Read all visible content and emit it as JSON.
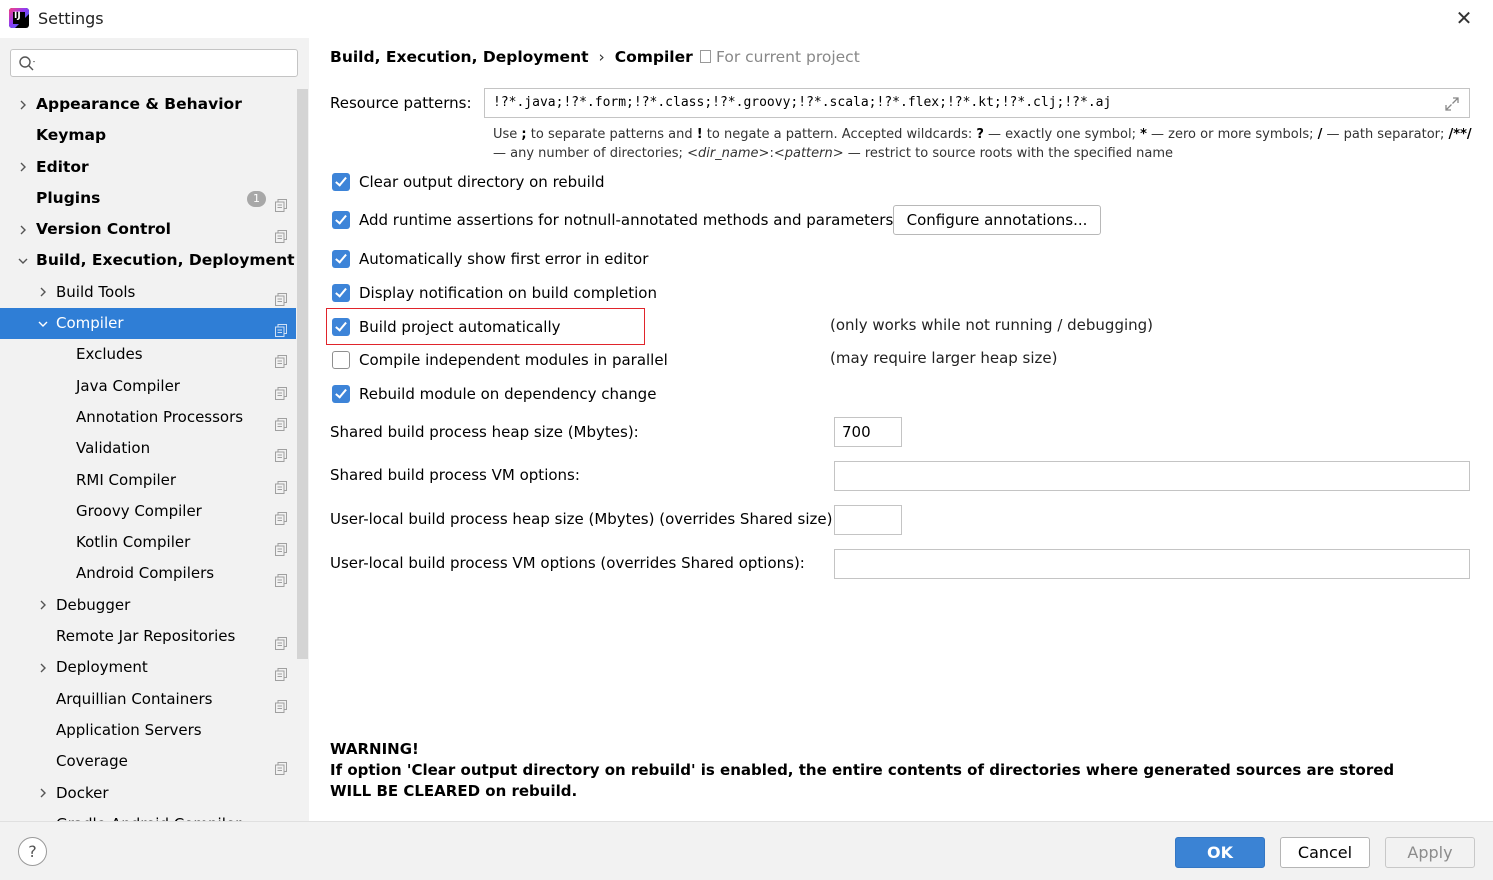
{
  "window": {
    "title": "Settings"
  },
  "sidebar": {
    "search_placeholder": "",
    "items": [
      {
        "label": "Appearance & Behavior",
        "level": 0,
        "arrow": "right",
        "copy": false
      },
      {
        "label": "Keymap",
        "level": 0,
        "arrow": "none",
        "copy": false
      },
      {
        "label": "Editor",
        "level": 0,
        "arrow": "right",
        "copy": false
      },
      {
        "label": "Plugins",
        "level": 0,
        "arrow": "none",
        "copy": true,
        "badge": "1"
      },
      {
        "label": "Version Control",
        "level": 0,
        "arrow": "right",
        "copy": true
      },
      {
        "label": "Build, Execution, Deployment",
        "level": 0,
        "arrow": "down",
        "copy": false
      },
      {
        "label": "Build Tools",
        "level": 1,
        "arrow": "right",
        "copy": true
      },
      {
        "label": "Compiler",
        "level": 1,
        "arrow": "down",
        "copy": true,
        "selected": true
      },
      {
        "label": "Excludes",
        "level": 2,
        "arrow": "none",
        "copy": true
      },
      {
        "label": "Java Compiler",
        "level": 2,
        "arrow": "none",
        "copy": true
      },
      {
        "label": "Annotation Processors",
        "level": 2,
        "arrow": "none",
        "copy": true
      },
      {
        "label": "Validation",
        "level": 2,
        "arrow": "none",
        "copy": true
      },
      {
        "label": "RMI Compiler",
        "level": 2,
        "arrow": "none",
        "copy": true
      },
      {
        "label": "Groovy Compiler",
        "level": 2,
        "arrow": "none",
        "copy": true
      },
      {
        "label": "Kotlin Compiler",
        "level": 2,
        "arrow": "none",
        "copy": true
      },
      {
        "label": "Android Compilers",
        "level": 2,
        "arrow": "none",
        "copy": true
      },
      {
        "label": "Debugger",
        "level": 1,
        "arrow": "right",
        "copy": false
      },
      {
        "label": "Remote Jar Repositories",
        "level": 1,
        "arrow": "none",
        "copy": true
      },
      {
        "label": "Deployment",
        "level": 1,
        "arrow": "right",
        "copy": true
      },
      {
        "label": "Arquillian Containers",
        "level": 1,
        "arrow": "none",
        "copy": true
      },
      {
        "label": "Application Servers",
        "level": 1,
        "arrow": "none",
        "copy": false
      },
      {
        "label": "Coverage",
        "level": 1,
        "arrow": "none",
        "copy": true
      },
      {
        "label": "Docker",
        "level": 1,
        "arrow": "right",
        "copy": false
      },
      {
        "label": "Gradle-Android Compiler",
        "level": 1,
        "arrow": "none",
        "copy": true
      }
    ]
  },
  "breadcrumb": {
    "parent": "Build, Execution, Deployment",
    "separator": "›",
    "current": "Compiler",
    "scope": "For current project"
  },
  "resource_patterns": {
    "label": "Resource patterns:",
    "value": "!?*.java;!?*.form;!?*.class;!?*.groovy;!?*.scala;!?*.flex;!?*.kt;!?*.clj;!?*.aj",
    "help": {
      "p1": "Use ",
      "b1": ";",
      "p2": " to separate patterns and ",
      "b2": "!",
      "p3": " to negate a pattern. Accepted wildcards: ",
      "b3": "?",
      "p4": " — exactly one symbol; ",
      "b4": "*",
      "p5": " — zero or more symbols; ",
      "b5": "/",
      "p6": " — path separator; ",
      "b6": "/**/",
      "p7": " — any number of directories; ",
      "i1": "<dir_name>",
      "p8": ":",
      "i2": "<pattern>",
      "p9": " — restrict to source roots with the specified name"
    }
  },
  "options": {
    "clear_output": {
      "label": "Clear output directory on rebuild",
      "checked": true
    },
    "runtime_assertions": {
      "label": "Add runtime assertions for notnull-annotated methods and parameters",
      "checked": true
    },
    "configure_annotations": "Configure annotations...",
    "show_first_error": {
      "label": "Automatically show first error in editor",
      "checked": true
    },
    "notify_completion": {
      "label": "Display notification on build completion",
      "checked": true
    },
    "build_auto": {
      "label": "Build project automatically",
      "checked": true,
      "note": "(only works while not running / debugging)"
    },
    "parallel": {
      "label": "Compile independent modules in parallel",
      "checked": false,
      "note": "(may require larger heap size)"
    },
    "rebuild_dep": {
      "label": "Rebuild module on dependency change",
      "checked": true
    }
  },
  "fields": {
    "shared_heap": {
      "label": "Shared build process heap size (Mbytes):",
      "value": "700"
    },
    "shared_vm": {
      "label": "Shared build process VM options:",
      "value": ""
    },
    "user_heap": {
      "label": "User-local build process heap size (Mbytes) (overrides Shared size):",
      "value": ""
    },
    "user_vm": {
      "label": "User-local build process VM options (overrides Shared options):",
      "value": ""
    }
  },
  "warning": {
    "title": "WARNING!",
    "text": "If option 'Clear output directory on rebuild' is enabled, the entire contents of directories where generated sources are stored WILL BE CLEARED on rebuild."
  },
  "footer": {
    "help": "?",
    "ok": "OK",
    "cancel": "Cancel",
    "apply": "Apply"
  },
  "colors": {
    "accent": "#2f7ed6",
    "checkbox": "#3d84d8",
    "highlight": "#e0242b",
    "sidebar_bg": "#f2f2f2"
  }
}
